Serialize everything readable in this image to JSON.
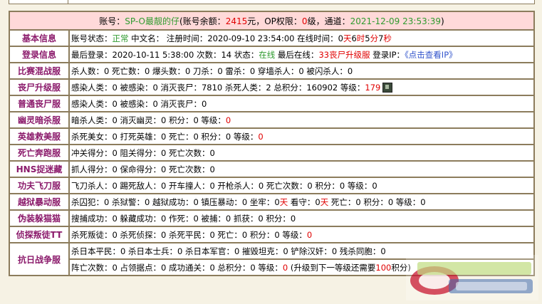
{
  "account": {
    "prefix": "账号：",
    "name": "SP-O最靓的仔",
    "balance_label": "(账号余额：",
    "balance": "2415",
    "op_label": "元，OP权限：",
    "op_level": "0",
    "channel_label": "级，通道：",
    "timestamp": "2021-12-09 23:53:39",
    "suffix": ")"
  },
  "rows": {
    "basic": {
      "label": "基本信息",
      "status_label": "账号状态：",
      "status": "正常",
      "cn_label": " 中文名： 注册时间：",
      "reg_time": "2020-09-10 23:54:00",
      "online_label": " 在线时间：",
      "d": "0",
      "d_unit": "天",
      "h": "6",
      "h_unit": "时",
      "m": "5",
      "m_unit": "分",
      "s": "7",
      "s_unit": "秒"
    },
    "login": {
      "label": "登录信息",
      "last_label": "最后登录：",
      "last_time": "2020-10-11 5:38:00",
      "count_label": " 次数：",
      "count": "14",
      "state_label": " 状态：",
      "state": "在线",
      "server_label": " 最后在线：",
      "server": "33丧尸升级服",
      "ip_label": " 登录IP：",
      "ip_link": "《点击查看IP》"
    },
    "mixed": {
      "label": "比赛混战服",
      "text": "杀人数：0 死亡数：0 爆头数：0 刀杀：0 雷杀：0 穿墙杀人：0 被闪杀人：0"
    },
    "zombie_up": {
      "label": "丧尸升级服",
      "text": "感染人类：0 被感染：0 消灭丧尸：7810 杀死人类：2 总积分：160902 等级：",
      "level": "179"
    },
    "zombie": {
      "label": "普通丧尸服",
      "text": "感染人类：0 被感染：0 消灭丧尸：0"
    },
    "ghost": {
      "label": "幽灵暗杀服",
      "text": "暗杀人类：0 消灭幽灵：0 积分：0 等级：",
      "level": "0"
    },
    "hero": {
      "label": "英雄救美服",
      "text": "杀死美女：0 打死英雄：0 死亡：0 积分：0 等级：",
      "level": "0"
    },
    "escape": {
      "label": "死亡奔跑服",
      "text": "冲关得分：0 阻关得分：0 死亡次数：0"
    },
    "hns": {
      "label": "HNS捉迷藏",
      "text": "抓人得分：0 保命得分：0 死亡次数：0"
    },
    "knife": {
      "label": "功夫飞刀服",
      "text": "飞刀杀人：0 踢死敌人：0 开车撞人：0 开枪杀人：0 死亡次数：0 积分：0 等级：0"
    },
    "jail": {
      "label": "越狱暴动服",
      "text1": "杀囚犯：0 杀狱警：0 越狱成功：0 镇压暴动：0 坐牢：0",
      "u1": "天",
      "text2": " 看守：0",
      "u2": "天",
      "text3": " 死亡：0 积分：0 等级：0"
    },
    "hide": {
      "label": "伪装躲猫猫",
      "text": "搜捕成功：0 躲藏成功：0 作死：0 被捕：0 抓获：0 积分：0"
    },
    "detect": {
      "label": "侦探叛徒TT",
      "text": "杀死叛徒：0 杀死侦探：0 杀死平民：0 死亡：0 积分：0 等级：",
      "level": "0"
    },
    "war": {
      "label": "抗日战争服",
      "text1": "杀日本平民：0 杀日本士兵：0 杀日本军官：0 摧毁坦克：0 铲除汉奸：0 残杀同胞：0",
      "text2": "阵亡次数：0 占领据点：0 成功通关：0 总积分：0 等级：",
      "level": "0",
      "upgrade_prefix": " (升级到下一等级还需要",
      "upgrade_need": "100",
      "upgrade_suffix": "积分)"
    }
  },
  "colors": {
    "label": "#8b1a6b",
    "header_bg": "#ffd9d9",
    "border": "#8c7c5c",
    "green": "#2f9b2f",
    "red": "#e00000",
    "blue": "#3355cc"
  },
  "icons": {
    "rank": "rank-badge-icon",
    "watermark": "site-watermark-logo"
  }
}
